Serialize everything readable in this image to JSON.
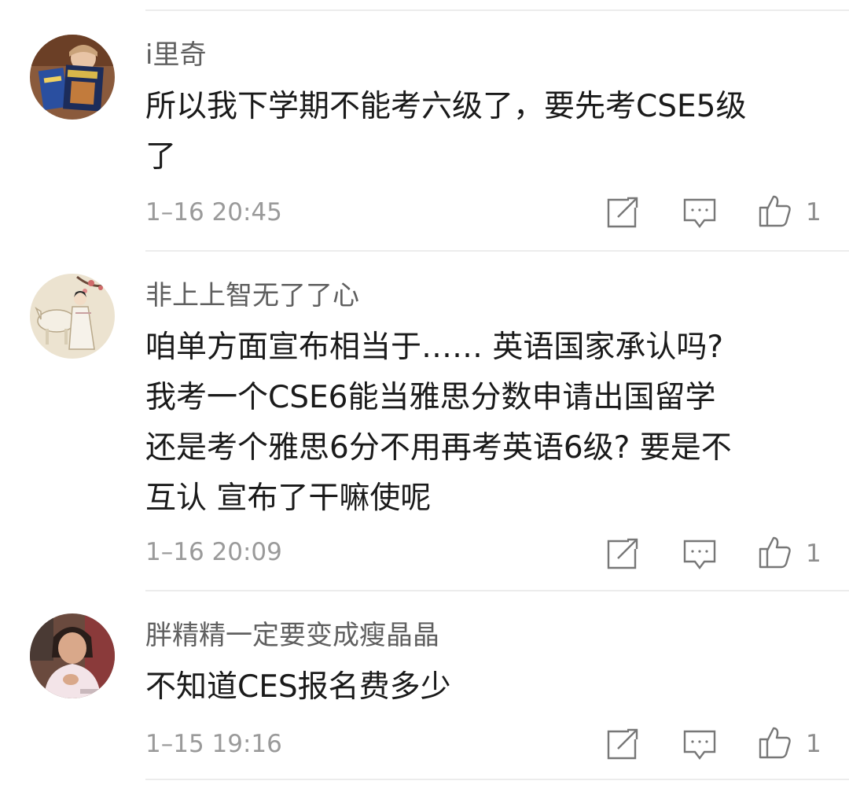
{
  "comments": [
    {
      "username": "i里奇",
      "lines": [
        "所以我下学期不能考六级了，要先考CSE5级",
        "了"
      ],
      "time": "1–16 20:45",
      "likes": "1",
      "avatar_icon": "reader-avatar-icon"
    },
    {
      "username": "非上上智无了了心",
      "lines": [
        "咱单方面宣布相当于…… 英语国家承认吗?",
        "我考一个CSE6能当雅思分数申请出国留学",
        "还是考个雅思6分不用再考英语6级? 要是不",
        "互认 宣布了干嘛使呢"
      ],
      "time": "1–16 20:09",
      "likes": "1",
      "avatar_icon": "painting-avatar-icon"
    },
    {
      "username": "胖精精一定要变成瘦晶晶",
      "lines": [
        "不知道CES报名费多少"
      ],
      "time": "1–15 19:16",
      "likes": "1",
      "avatar_icon": "person-avatar-icon"
    }
  ],
  "icons": {
    "share": "share-icon",
    "reply": "comment-icon",
    "like": "thumbs-up-icon"
  },
  "colors": {
    "username": "#5f5f5f",
    "text": "#1a1a1a",
    "meta": "#9a9a9a",
    "divider": "#ececec"
  }
}
